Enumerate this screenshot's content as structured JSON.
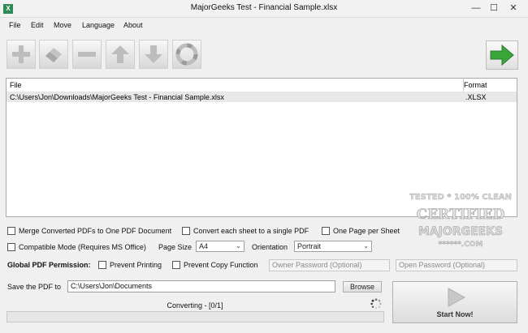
{
  "window": {
    "title": "MajorGeeks Test - Financial Sample.xlsx"
  },
  "menu": [
    "File",
    "Edit",
    "Move",
    "Language",
    "About"
  ],
  "toolbar": [
    "add-icon",
    "erase-icon",
    "remove-icon",
    "move-up-icon",
    "move-down-icon",
    "help-icon"
  ],
  "file_list": {
    "headers": {
      "file": "File",
      "format": "Format"
    },
    "rows": [
      {
        "file": "C:\\Users\\Jon\\Downloads\\MajorGeeks Test - Financial Sample.xlsx",
        "format": ".XLSX"
      }
    ]
  },
  "options": {
    "merge": "Merge Converted PDFs to One PDF Document",
    "single_pdf": "Convert each sheet to a single PDF",
    "one_page": "One Page per Sheet",
    "compatible": "Compatible Mode (Requires MS Office)",
    "page_size_label": "Page Size",
    "page_size_value": "A4",
    "orientation_label": "Orientation",
    "orientation_value": "Portrait"
  },
  "permission": {
    "label": "Global PDF Permission:",
    "prevent_printing": "Prevent Printing",
    "prevent_copy": "Prevent Copy Function",
    "owner_password": "Owner Password (Optional)",
    "open_password": "Open Password (Optional)"
  },
  "save": {
    "label": "Save the PDF to",
    "path": "C:\\Users\\Jon\\Documents",
    "browse": "Browse"
  },
  "status": {
    "text": "Converting - [0/1]",
    "progress": 0
  },
  "start": {
    "label": "Start Now!"
  },
  "watermark": {
    "line1": "TESTED * 100% CLEAN",
    "line2": "CERTIFIED",
    "line3": "MAJORGEEKS",
    "line4": "******.COM"
  },
  "colors": {
    "accent_green": "#3aa63a"
  }
}
